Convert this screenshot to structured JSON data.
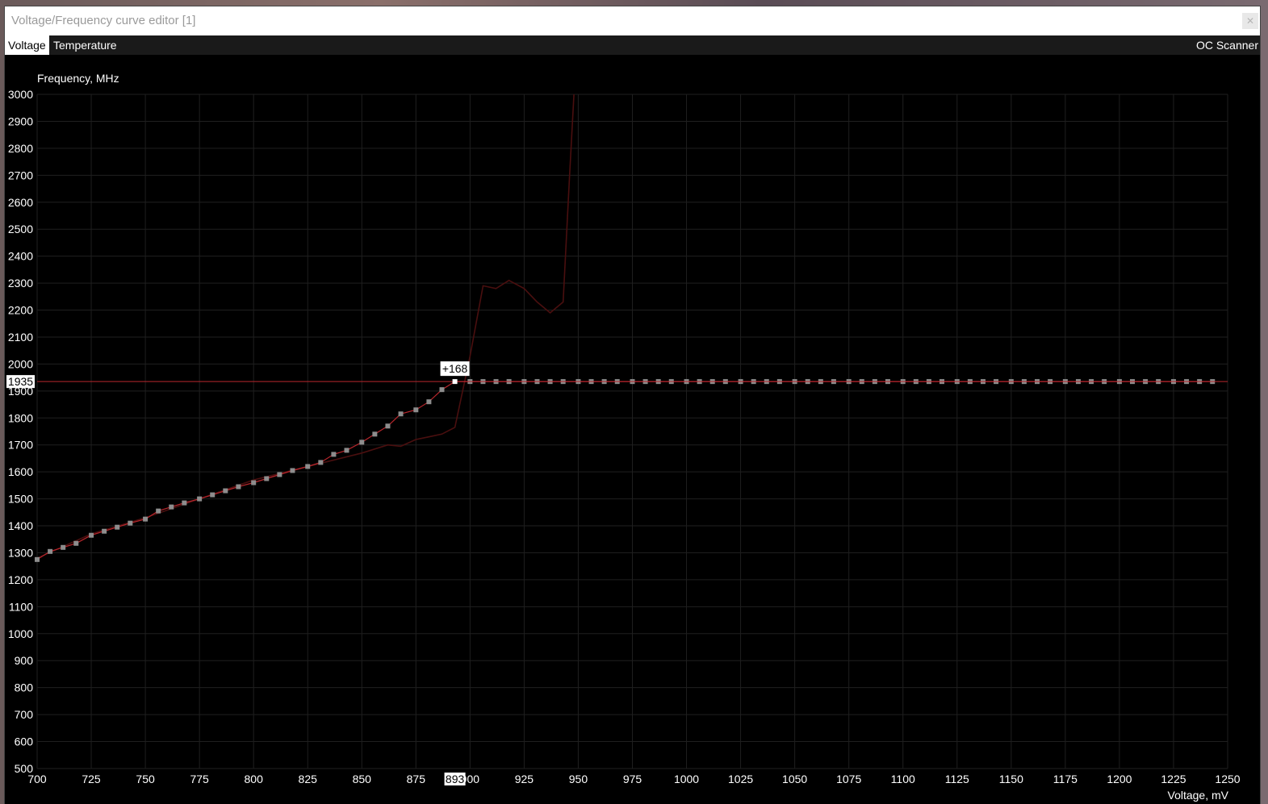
{
  "window": {
    "title": "Voltage/Frequency curve editor [1]",
    "close_icon": "close-icon"
  },
  "tabs": {
    "voltage": "Voltage",
    "temperature": "Temperature",
    "oc_scanner": "OC Scanner"
  },
  "colors": {
    "curve": "#b8262c",
    "points": "#8d8d8d",
    "selected_point": "#ffffff",
    "reference_curve": "#4a0f0f",
    "grid": "#1f1f1f"
  },
  "chart_data": {
    "type": "line",
    "ylabel": "Frequency, MHz",
    "xlabel": "Voltage, mV",
    "xlim": [
      700,
      1250
    ],
    "ylim": [
      500,
      3000
    ],
    "x_ticks": [
      700,
      725,
      750,
      775,
      800,
      825,
      850,
      875,
      900,
      925,
      950,
      975,
      1000,
      1025,
      1050,
      1075,
      1100,
      1125,
      1150,
      1175,
      1200,
      1225,
      1250
    ],
    "y_ticks": [
      500,
      600,
      700,
      800,
      900,
      1000,
      1100,
      1200,
      1300,
      1400,
      1500,
      1600,
      1700,
      1800,
      1900,
      2000,
      2100,
      2200,
      2300,
      2400,
      2500,
      2600,
      2700,
      2800,
      2900,
      3000
    ],
    "grid": true,
    "selected_point": {
      "voltage": 893,
      "frequency": 1935,
      "offset_label": "+168",
      "voltage_label": "893",
      "frequency_label": "1935"
    },
    "series": [
      {
        "role": "curve",
        "x": [
          700,
          706,
          712,
          718,
          725,
          731,
          737,
          743,
          750,
          756,
          762,
          768,
          775,
          781,
          787,
          793,
          800,
          806,
          812,
          818,
          825,
          831,
          837,
          843,
          850,
          856,
          862,
          868,
          875,
          881,
          887,
          893,
          900,
          906,
          912,
          918,
          925,
          931,
          937,
          943,
          950,
          956,
          962,
          968,
          975,
          981,
          987,
          993,
          1000,
          1006,
          1012,
          1018,
          1025,
          1031,
          1037,
          1043,
          1050,
          1056,
          1062,
          1068,
          1075,
          1081,
          1087,
          1093,
          1100,
          1106,
          1112,
          1118,
          1125,
          1131,
          1137,
          1143,
          1150,
          1156,
          1162,
          1168,
          1175,
          1181,
          1187,
          1193,
          1200,
          1206,
          1212,
          1218,
          1225,
          1231,
          1237,
          1243
        ],
        "y": [
          1275,
          1305,
          1320,
          1335,
          1365,
          1380,
          1395,
          1410,
          1425,
          1455,
          1470,
          1485,
          1500,
          1515,
          1530,
          1545,
          1560,
          1575,
          1590,
          1605,
          1620,
          1635,
          1665,
          1680,
          1710,
          1740,
          1770,
          1815,
          1830,
          1860,
          1905,
          1935,
          1935,
          1935,
          1935,
          1935,
          1935,
          1935,
          1935,
          1935,
          1935,
          1935,
          1935,
          1935,
          1935,
          1935,
          1935,
          1935,
          1935,
          1935,
          1935,
          1935,
          1935,
          1935,
          1935,
          1935,
          1935,
          1935,
          1935,
          1935,
          1935,
          1935,
          1935,
          1935,
          1935,
          1935,
          1935,
          1935,
          1935,
          1935,
          1935,
          1935,
          1935,
          1935,
          1935,
          1935,
          1935,
          1935,
          1935,
          1935,
          1935,
          1935,
          1935,
          1935,
          1935,
          1935,
          1935,
          1935
        ]
      },
      {
        "role": "reference",
        "x": [
          700,
          725,
          750,
          775,
          800,
          825,
          850,
          862,
          868,
          875,
          881,
          887,
          893,
          900,
          906,
          912,
          918,
          925,
          931,
          937,
          943,
          946,
          948
        ],
        "y": [
          1280,
          1370,
          1430,
          1500,
          1570,
          1620,
          1670,
          1700,
          1695,
          1720,
          1730,
          1740,
          1765,
          2030,
          2290,
          2280,
          2310,
          2280,
          2230,
          2190,
          2230,
          2700,
          3000
        ]
      }
    ]
  }
}
